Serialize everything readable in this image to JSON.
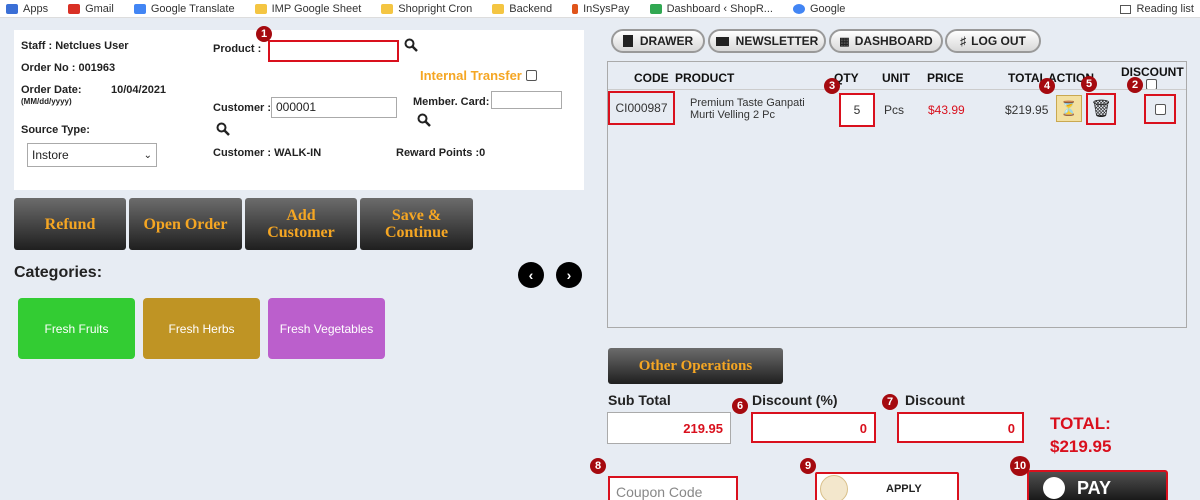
{
  "bookmarks": {
    "items": [
      {
        "label": "Apps",
        "color": "#3b6fd6"
      },
      {
        "label": "Gmail",
        "color": "#d93025"
      },
      {
        "label": "Google Translate",
        "color": "#4285f4"
      },
      {
        "label": "IMP Google Sheet",
        "color": "#f4c542"
      },
      {
        "label": "Shopright Cron",
        "color": "#f4c542"
      },
      {
        "label": "Backend",
        "color": "#f4c542"
      },
      {
        "label": "InSysPay",
        "color": "#e0541a"
      },
      {
        "label": "Dashboard ‹ ShopR...",
        "color": "#31a852"
      },
      {
        "label": "Google",
        "color": "#4285f4"
      }
    ],
    "reading_list": "Reading list"
  },
  "order": {
    "staff": "Staff : Netclues User",
    "order_no": "Order No : 001963",
    "order_date_label": "Order Date:",
    "order_date_format": "(MM/dd/yyyy)",
    "order_date": "10/04/2021",
    "source_type_label": "Source Type:",
    "source_type": "Instore",
    "product_label": "Product :",
    "product_value": "",
    "internal_transfer": "Internal Transfer",
    "customer_label": "Customer :",
    "customer_value": "000001",
    "member_card_label": "Member. Card:",
    "member_card_value": "",
    "customer_name": "Customer : WALK-IN",
    "reward_points": "Reward Points :0"
  },
  "actions": {
    "refund": "Refund",
    "open_order": "Open Order",
    "add_customer": "Add Customer",
    "save_continue": "Save & Continue"
  },
  "categories": {
    "title": "Categories:",
    "items": [
      {
        "label": "Fresh Fruits",
        "color": "#33cc33"
      },
      {
        "label": "Fresh Herbs",
        "color": "#bf9424"
      },
      {
        "label": "Fresh Vegetables",
        "color": "#bb5fcc"
      }
    ]
  },
  "top_nav": {
    "drawer": "DRAWER",
    "newsletter": "NEWSLETTER",
    "dashboard": "DASHBOARD",
    "logout": "LOG OUT"
  },
  "cart": {
    "headers": {
      "code": "CODE",
      "product": "PRODUCT",
      "qty": "QTY",
      "unit": "UNIT",
      "price": "PRICE",
      "total": "TOTAL",
      "action": "ACTION",
      "discount": "DISCOUNT"
    },
    "rows": [
      {
        "code": "CI000987",
        "product": "Premium Taste Ganpati Murti Velling 2 Pc",
        "qty": "5",
        "unit": "Pcs",
        "price": "$43.99",
        "total": "$219.95"
      }
    ]
  },
  "summary": {
    "other_operations": "Other Operations",
    "sub_total_label": "Sub Total",
    "sub_total": "219.95",
    "discount_pct_label": "Discount (%)",
    "discount_pct": "0",
    "discount_label": "Discount",
    "discount": "0",
    "total_label": "TOTAL:",
    "total": "$219.95",
    "coupon_placeholder": "Coupon Code",
    "apply": "APPLY",
    "pay": "PAY"
  },
  "markers": [
    "1",
    "2",
    "3",
    "4",
    "5",
    "6",
    "7",
    "8",
    "9",
    "10"
  ],
  "colors": {
    "marker": "#a50a0f",
    "highlight": "#d9101d",
    "accent": "#f5a623"
  }
}
